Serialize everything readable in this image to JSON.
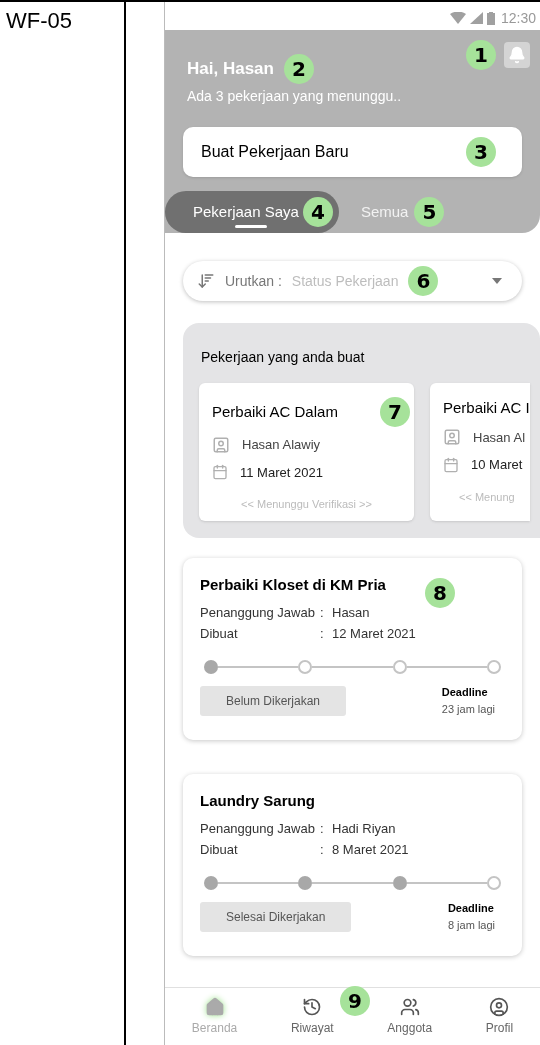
{
  "label": "WF-05",
  "status_bar": {
    "time": "12:30"
  },
  "header": {
    "greeting": "Hai, Hasan",
    "subtitle": "Ada 3 pekerjaan yang menunggu..",
    "greeting_marker": "2",
    "bell_marker": "1"
  },
  "create_button": {
    "label": "Buat Pekerjaan Baru",
    "marker": "3"
  },
  "tabs": [
    {
      "label": "Pekerjaan Saya",
      "selected": true,
      "marker": "4"
    },
    {
      "label": "Semua",
      "selected": false,
      "marker": "5"
    }
  ],
  "sort": {
    "label": "Urutkan :",
    "value": "Status Pekerjaan",
    "marker": "6"
  },
  "created_section": {
    "title": "Pekerjaan yang anda buat",
    "marker": "7",
    "cards": [
      {
        "title": "Perbaiki AC Dalam",
        "person": "Hasan Alawiy",
        "date": "11 Maret 2021",
        "status": "<< Menunggu Verifikasi >>"
      },
      {
        "title": "Perbaiki AC I",
        "person": "Hasan Al",
        "date": "10 Maret",
        "status": "<< Menung"
      }
    ]
  },
  "tasks": [
    {
      "title": "Perbaiki Kloset di KM Pria",
      "marker": "8",
      "separator": ":",
      "person_label": "Penanggung Jawab",
      "person": "Hasan",
      "created_label": "Dibuat",
      "created": "12 Maret 2021",
      "steps": [
        {
          "done": true
        },
        {
          "done": false
        },
        {
          "done": false
        },
        {
          "done": false
        }
      ],
      "status": "Belum Dikerjakan",
      "deadline_label": "Deadline",
      "deadline": "23 jam lagi"
    },
    {
      "title": "Laundry Sarung",
      "separator": ":",
      "person_label": "Penanggung Jawab",
      "person": "Hadi Riyan",
      "created_label": "Dibuat",
      "created": "8 Maret 2021",
      "steps": [
        {
          "done": true
        },
        {
          "done": true
        },
        {
          "done": true
        },
        {
          "done": false
        }
      ],
      "status": "Selesai Dikerjakan",
      "deadline_label": "Deadline",
      "deadline": "8 jam lagi"
    }
  ],
  "nav": {
    "marker": "9",
    "items": [
      {
        "kind": "home",
        "label": "Beranda",
        "selected": true
      },
      {
        "kind": "history",
        "label": "Riwayat",
        "selected": false
      },
      {
        "kind": "members",
        "label": "Anggota",
        "selected": false
      },
      {
        "kind": "profile",
        "label": "Profil",
        "selected": false
      }
    ]
  }
}
